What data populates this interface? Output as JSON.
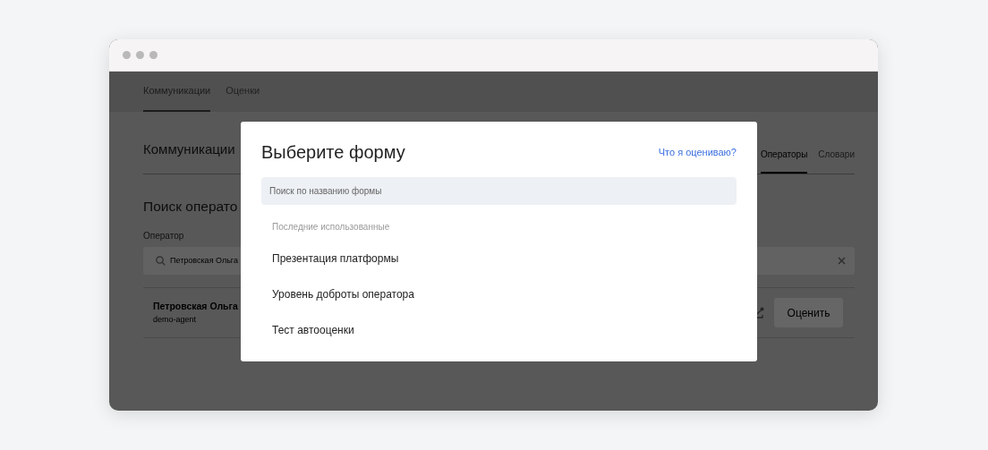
{
  "nav_tabs": [
    {
      "label": "Коммуникации",
      "selected": true
    },
    {
      "label": "Оценки",
      "selected": false
    }
  ],
  "page": {
    "title": "Коммуникации",
    "tabs": [
      {
        "label": "Операторы",
        "selected": true
      },
      {
        "label": "Словари",
        "selected": false
      }
    ],
    "section_title": "Поиск операто",
    "operator_field": {
      "label": "Оператор",
      "value": "Петровская Ольга"
    },
    "operators": [
      {
        "name": "Петровская Ольга",
        "login": "demo-agent",
        "button": "Оценить"
      }
    ]
  },
  "modal": {
    "title": "Выберите форму",
    "help_link": "Что я оцениваю?",
    "search": {
      "placeholder": "Поиск по названию формы"
    },
    "recent_label": "Последние использованные",
    "forms": [
      "Презентация платформы",
      "Уровень доброты оператора",
      "Тест автооценки"
    ]
  }
}
